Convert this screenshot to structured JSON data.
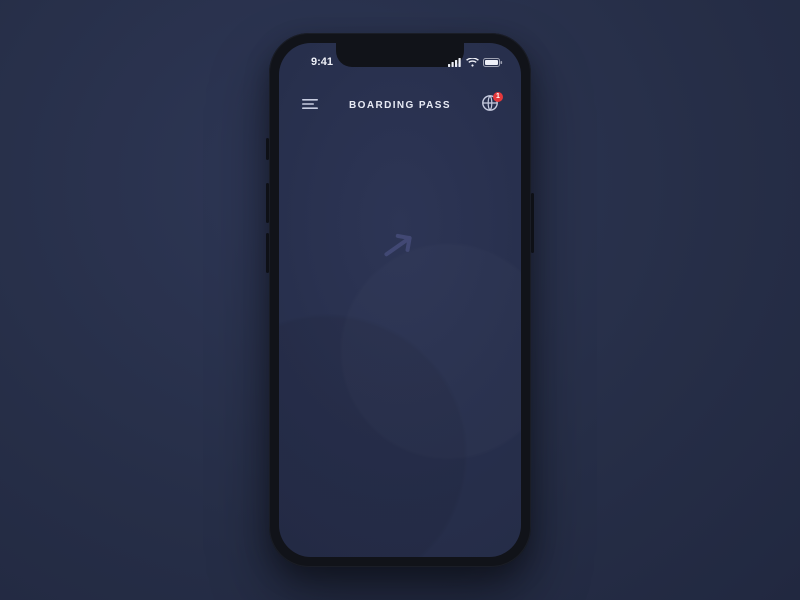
{
  "status": {
    "time": "9:41"
  },
  "header": {
    "title": "BOARDING PASS",
    "notification_count": "1"
  },
  "colors": {
    "background": "#262e47",
    "accent_badge": "#e5383b",
    "text": "#e8ebf5"
  }
}
